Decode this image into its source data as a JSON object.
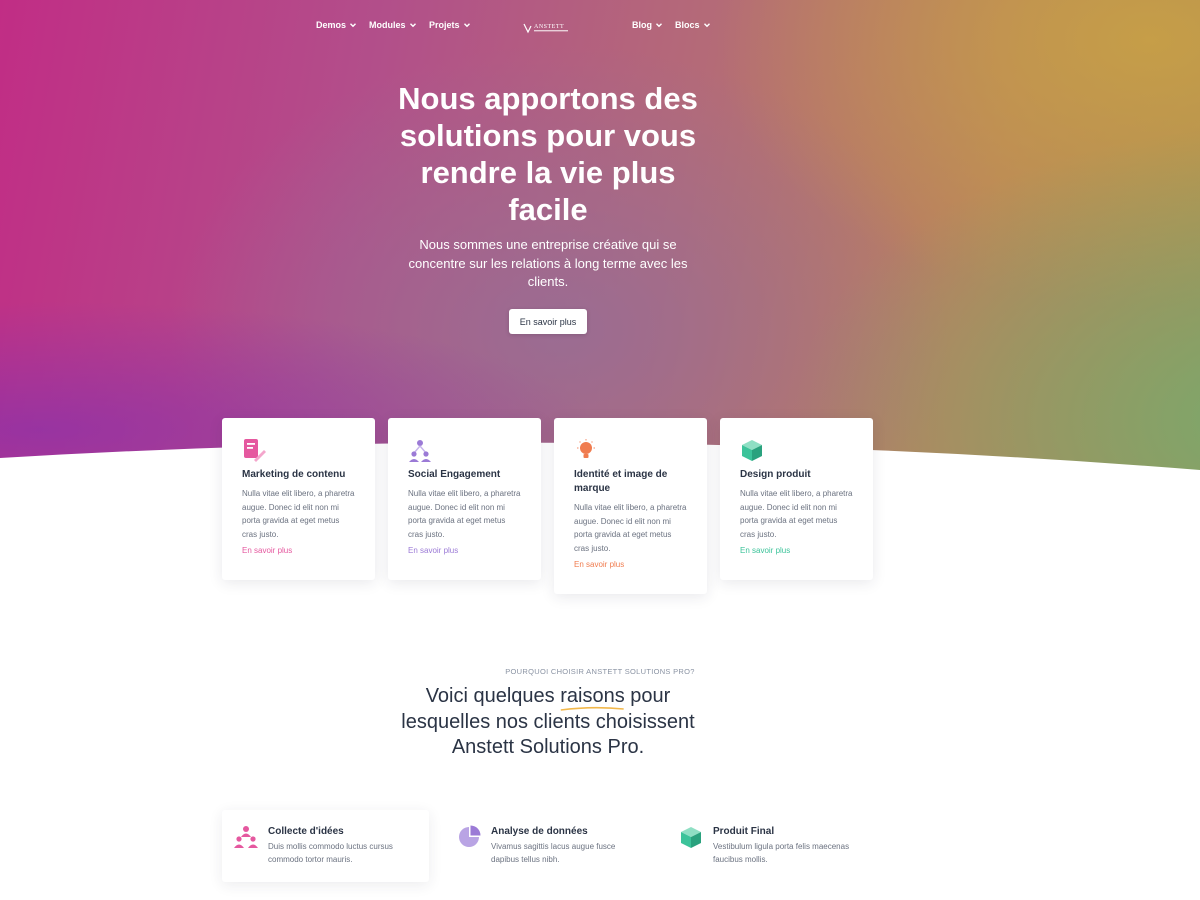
{
  "nav": {
    "left": [
      "Demos",
      "Modules",
      "Projets"
    ],
    "right": [
      "Blog",
      "Blocs"
    ],
    "logo": "ANSTETT"
  },
  "hero": {
    "title": "Nous apportons des solutions pour vous rendre la vie plus facile",
    "subtitle": "Nous sommes une entreprise créative qui se concentre sur les relations à long terme avec les clients.",
    "button": "En savoir plus"
  },
  "services": [
    {
      "title": "Marketing de contenu",
      "text": "Nulla vitae elit libero, a pharetra augue. Donec id elit non mi porta gravida at eget metus cras justo.",
      "link": "En savoir plus",
      "color": "#e5589f",
      "icon": "document-edit-icon"
    },
    {
      "title": "Social Engagement",
      "text": "Nulla vitae elit libero, a pharetra augue. Donec id elit non mi porta gravida at eget metus cras justo.",
      "link": "En savoir plus",
      "color": "#9b7ad6",
      "icon": "users-network-icon"
    },
    {
      "title": "Identité et image de marque",
      "text": "Nulla vitae elit libero, a pharetra augue. Donec id elit non mi porta gravida at eget metus cras justo.",
      "link": "En savoir plus",
      "color": "#f07c4f",
      "icon": "lightbulb-icon"
    },
    {
      "title": "Design produit",
      "text": "Nulla vitae elit libero, a pharetra augue. Donec id elit non mi porta gravida at eget metus cras justo.",
      "link": "En savoir plus",
      "color": "#3cc39a",
      "icon": "box-icon"
    }
  ],
  "why": {
    "eyebrow": "POURQUOI CHOISIR ANSTETT SOLUTIONS PRO?",
    "title_before": "Voici quelques",
    "title_highlight": "raisons",
    "title_after": "pour lesquelles nos clients choisissent Anstett Solutions Pro.",
    "accent": "#f2b84b"
  },
  "features": [
    {
      "title": "Collecte d'idées",
      "text": "Duis mollis commodo luctus cursus commodo tortor mauris.",
      "icon": "team-icon",
      "color": "#e5589f"
    },
    {
      "title": "Analyse de données",
      "text": "Vivamus sagittis lacus augue fusce dapibus tellus nibh.",
      "icon": "pie-chart-icon",
      "color": "#9b7ad6"
    },
    {
      "title": "Produit Final",
      "text": "Vestibulum ligula porta felis maecenas faucibus mollis.",
      "icon": "box-icon",
      "color": "#3cc39a"
    }
  ]
}
